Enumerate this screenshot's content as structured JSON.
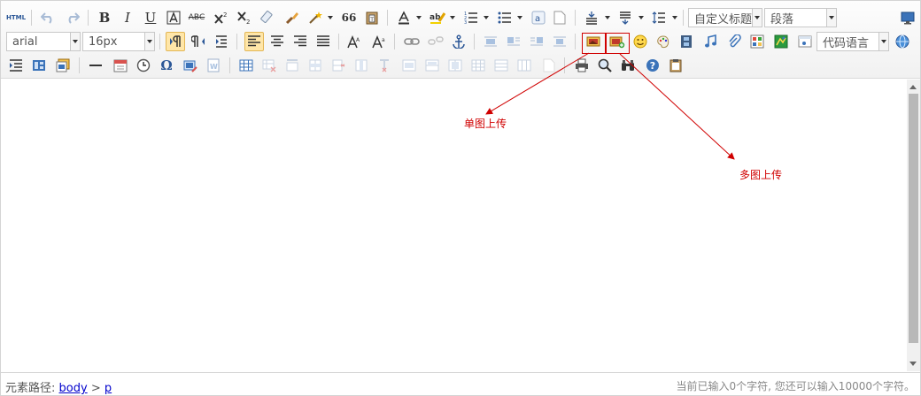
{
  "toolbar": {
    "heading_select": {
      "value": "自定义标题"
    },
    "paragraph_select": {
      "value": "段落"
    },
    "font_family_select": {
      "value": "arial"
    },
    "font_size_select": {
      "value": "16px"
    },
    "code_language_select": {
      "value": "代码语言"
    },
    "html_label": "HTML",
    "bold_label": "B",
    "italic_label": "I",
    "underline_label": "U",
    "strike_label": "ABC",
    "quote_label": "66",
    "omega_label": "Ω",
    "help_label": "?",
    "highlighted_buttons": [
      "simpleupload",
      "insertimage"
    ]
  },
  "annotations": {
    "single_upload": "单图上传",
    "multi_upload": "多图上传",
    "color": "#d00000"
  },
  "statusbar": {
    "path_label": "元素路径:",
    "path_items": [
      "body",
      "p"
    ],
    "path_separator": ">",
    "word_count": "当前已输入0个字符, 您还可以输入10000个字符。"
  }
}
